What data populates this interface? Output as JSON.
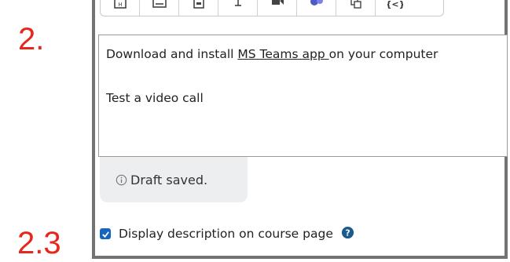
{
  "annotations": {
    "step_a": "2.",
    "step_b": "2.3"
  },
  "toolbar": {
    "buttons": [
      "h5p-icon",
      "media-icon",
      "image-icon",
      "record-audio-icon",
      "record-video-icon",
      "teams-icon",
      "copy-icon",
      "code-icon"
    ]
  },
  "editor": {
    "line1_before": "Download and install ",
    "line1_link": "MS Teams app ",
    "line1_after": "on your computer",
    "line2": "Test a video call"
  },
  "status": {
    "draft_text": "Draft saved."
  },
  "display_option": {
    "label": "Display description on course page",
    "checked": true
  },
  "colors": {
    "annotation": "#e8261c",
    "accent": "#1565c0",
    "frame": "#737373"
  }
}
